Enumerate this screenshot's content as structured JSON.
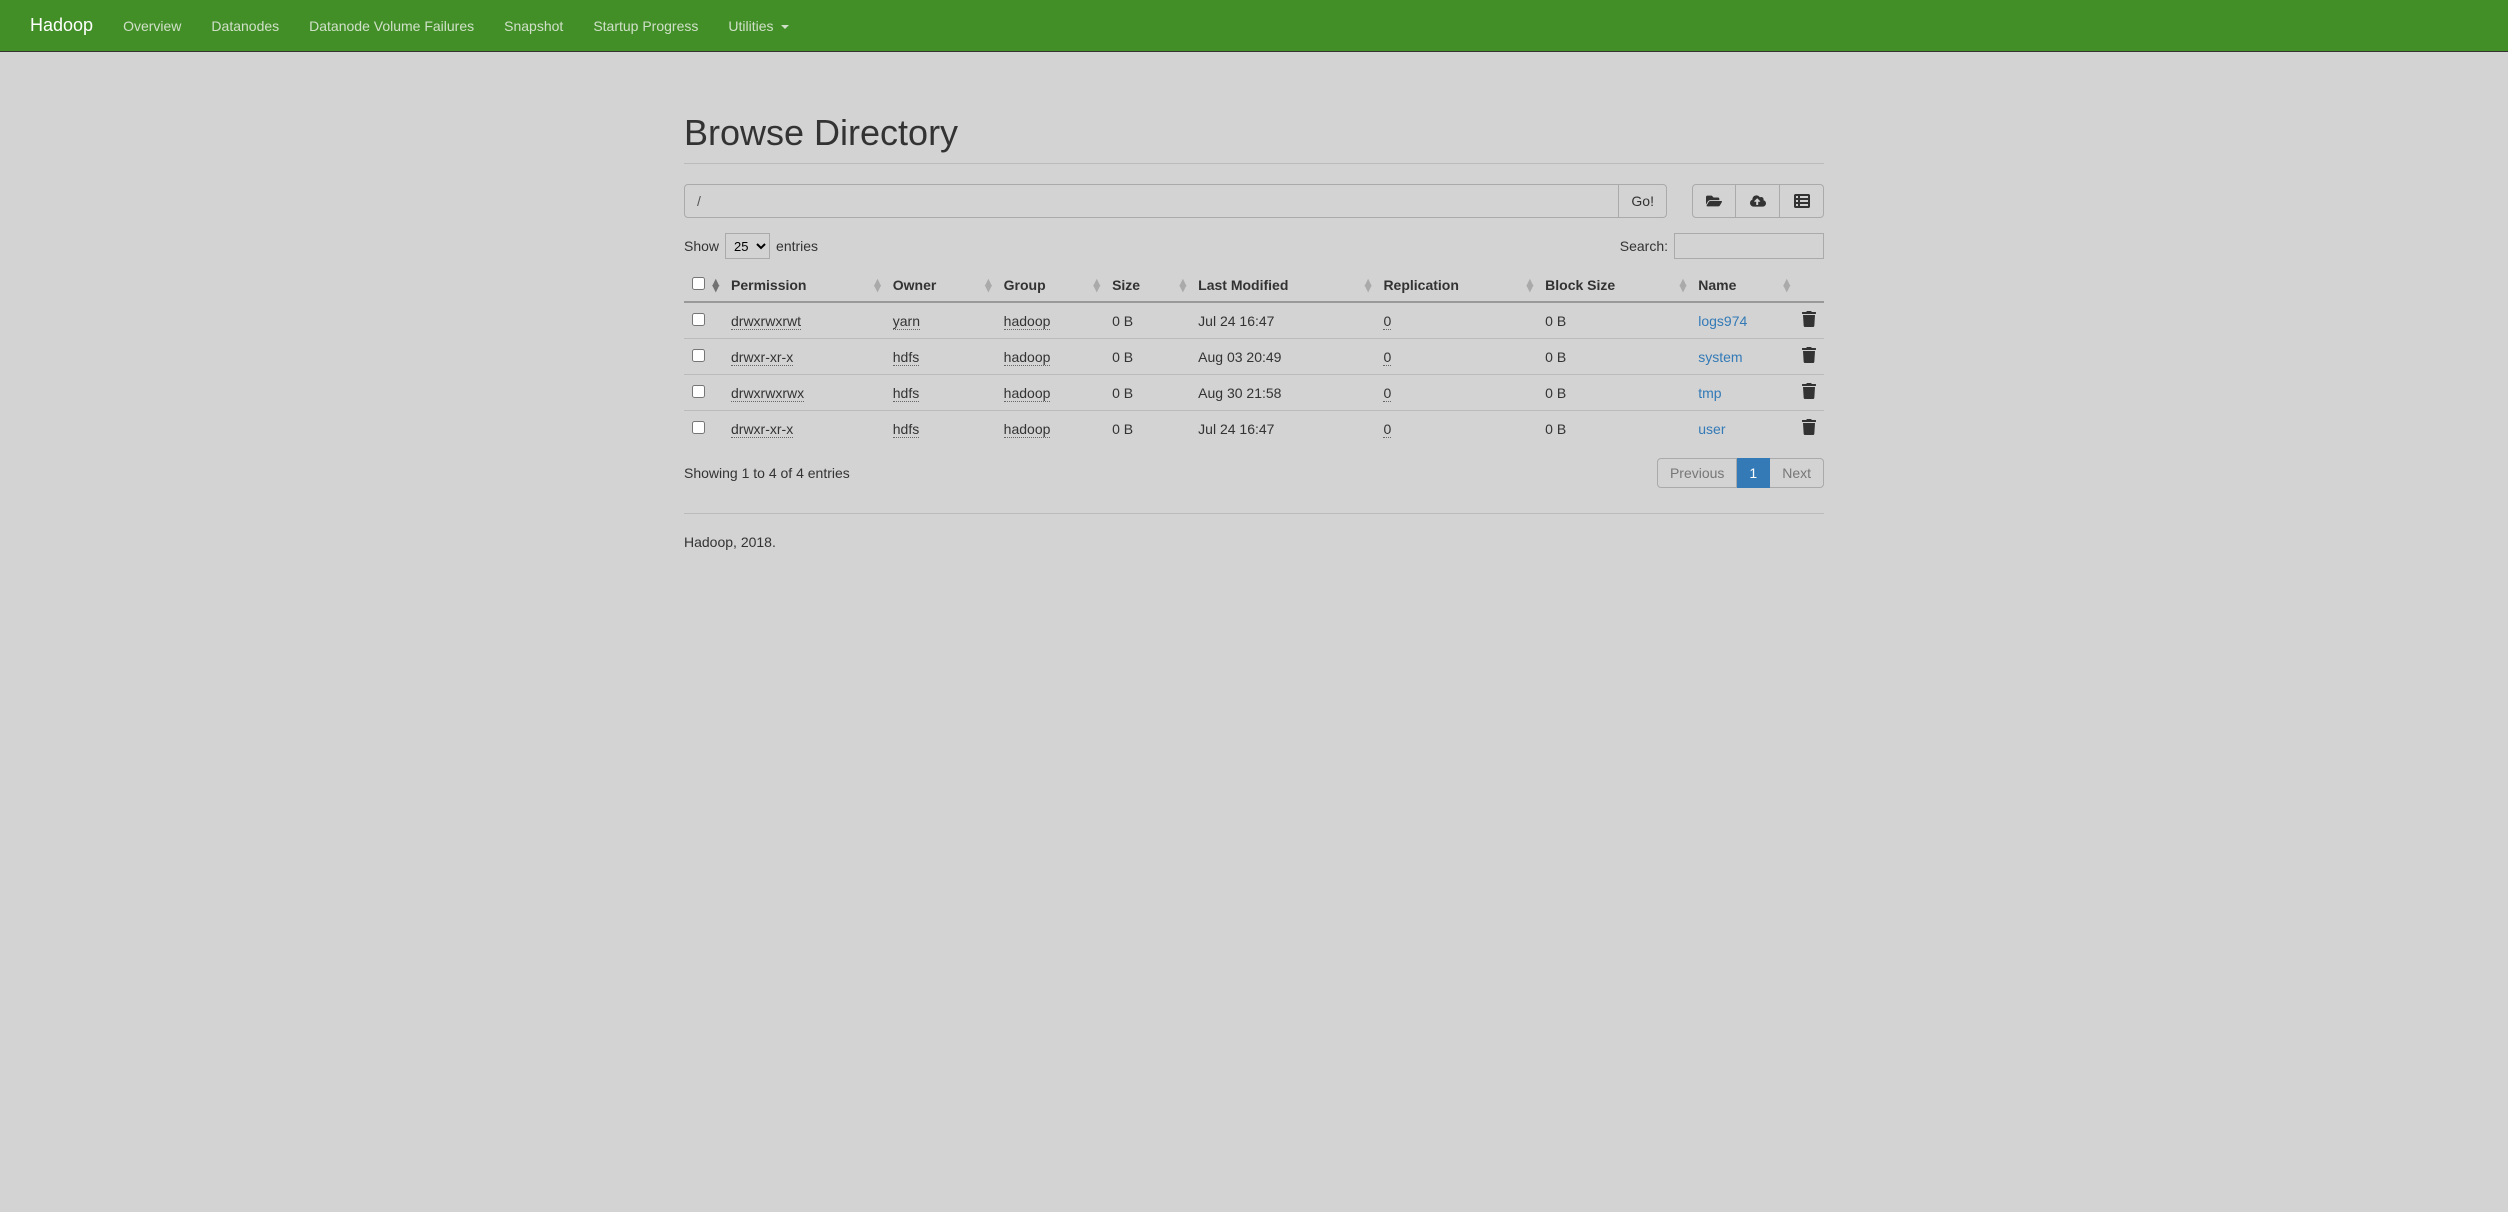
{
  "navbar": {
    "brand": "Hadoop",
    "items": [
      "Overview",
      "Datanodes",
      "Datanode Volume Failures",
      "Snapshot",
      "Startup Progress",
      "Utilities"
    ]
  },
  "page_title": "Browse Directory",
  "path_input": {
    "value": "/"
  },
  "go_button": "Go!",
  "show_entries": {
    "prefix": "Show",
    "value": "25",
    "suffix": "entries"
  },
  "search": {
    "label": "Search:"
  },
  "columns": [
    "",
    "Permission",
    "Owner",
    "Group",
    "Size",
    "Last Modified",
    "Replication",
    "Block Size",
    "Name",
    ""
  ],
  "rows": [
    {
      "permission": "drwxrwxrwt",
      "owner": "yarn",
      "group": "hadoop",
      "size": "0 B",
      "modified": "Jul 24 16:47",
      "replication": "0",
      "block_size": "0 B",
      "name": "logs974"
    },
    {
      "permission": "drwxr-xr-x",
      "owner": "hdfs",
      "group": "hadoop",
      "size": "0 B",
      "modified": "Aug 03 20:49",
      "replication": "0",
      "block_size": "0 B",
      "name": "system"
    },
    {
      "permission": "drwxrwxrwx",
      "owner": "hdfs",
      "group": "hadoop",
      "size": "0 B",
      "modified": "Aug 30 21:58",
      "replication": "0",
      "block_size": "0 B",
      "name": "tmp"
    },
    {
      "permission": "drwxr-xr-x",
      "owner": "hdfs",
      "group": "hadoop",
      "size": "0 B",
      "modified": "Jul 24 16:47",
      "replication": "0",
      "block_size": "0 B",
      "name": "user"
    }
  ],
  "info_text": "Showing 1 to 4 of 4 entries",
  "pagination": {
    "previous": "Previous",
    "current": "1",
    "next": "Next"
  },
  "footer": "Hadoop, 2018."
}
